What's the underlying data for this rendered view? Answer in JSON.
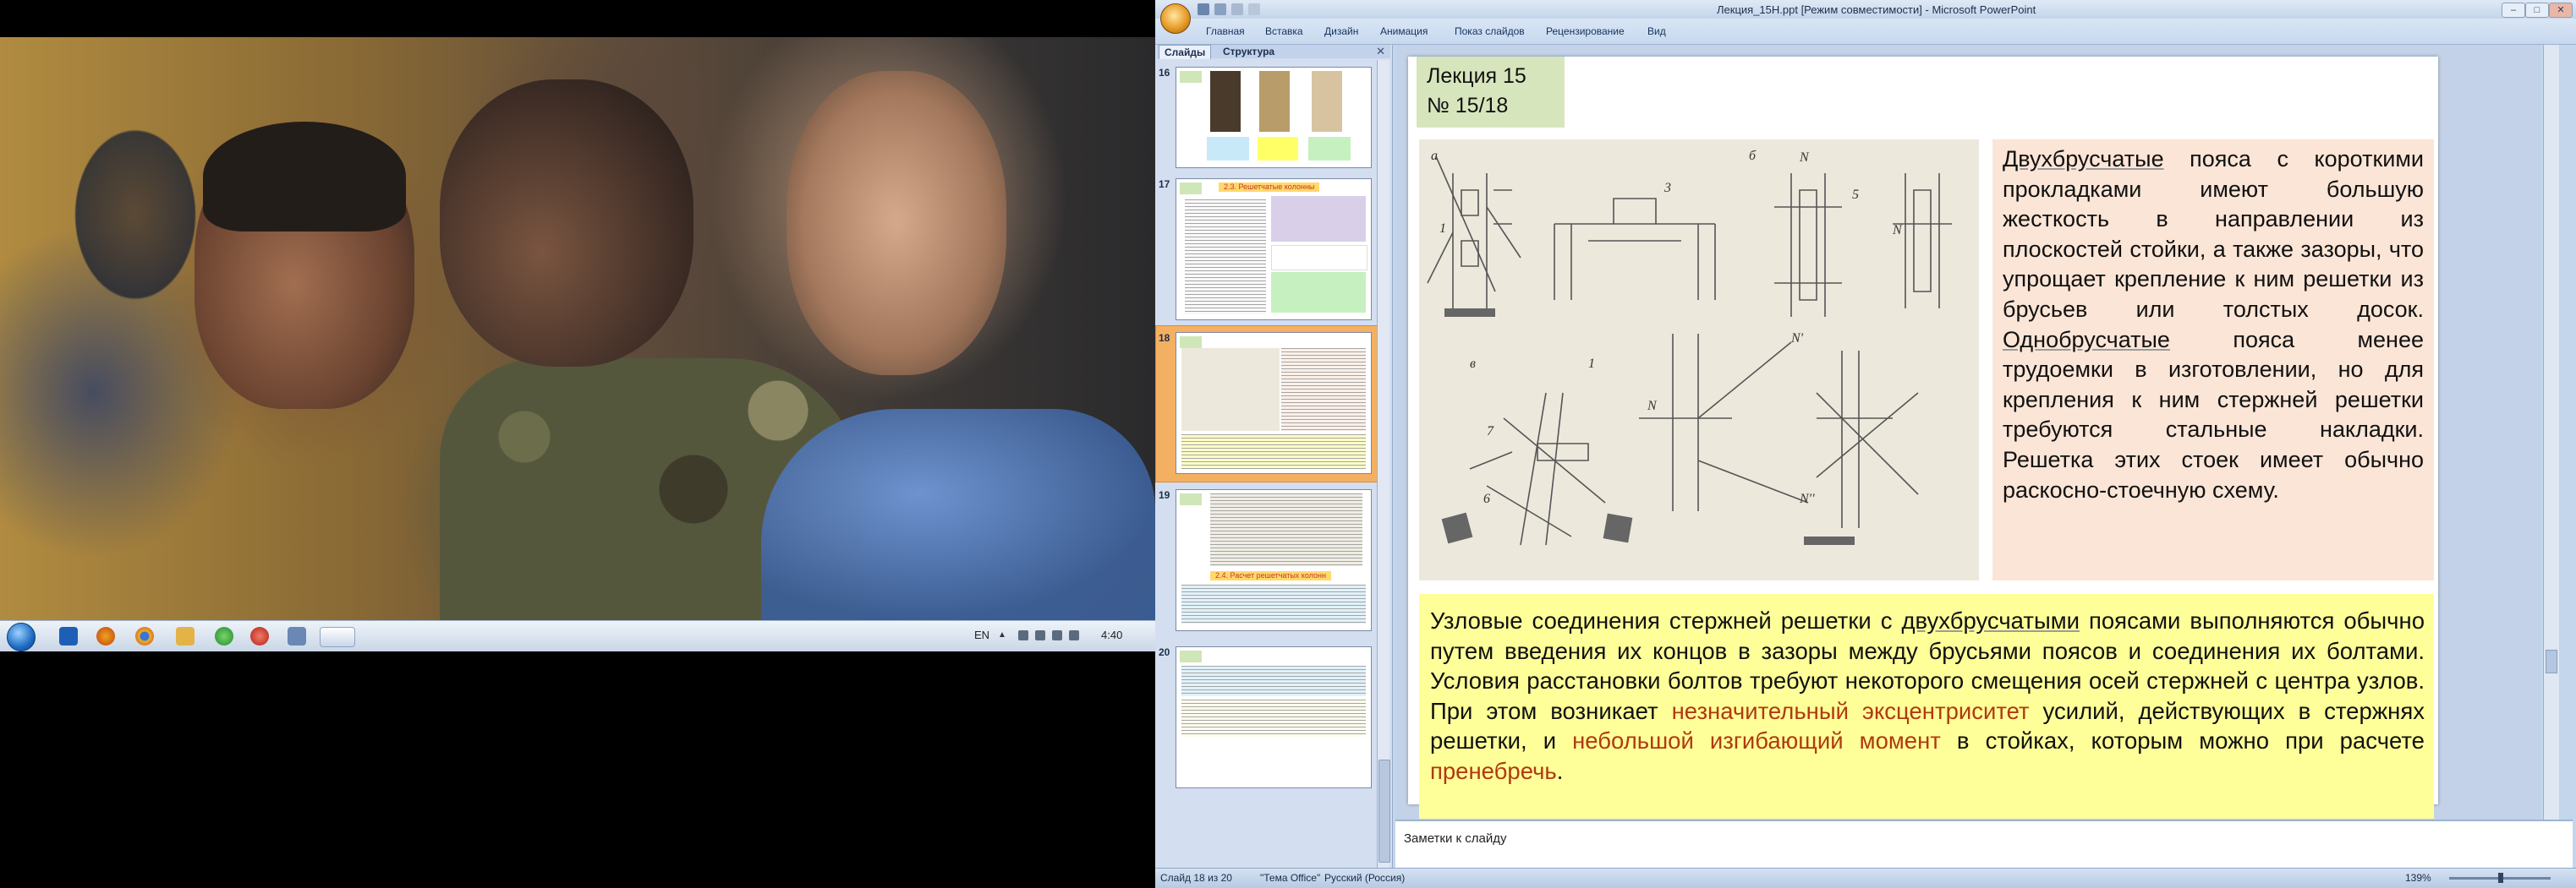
{
  "taskbar": {
    "lang": "EN",
    "clock": "4:40",
    "icons": [
      "start",
      "media-player",
      "firefox",
      "chrome",
      "file-explorer",
      "green-app",
      "red-app",
      "window-app",
      "active-app"
    ]
  },
  "ppt": {
    "window_title": "Лекция_15Н.ppt [Режим совместимости] - Microsoft PowerPoint",
    "ribbon_tabs": [
      "Главная",
      "Вставка",
      "Дизайн",
      "Анимация",
      "Показ слайдов",
      "Рецензирование",
      "Вид"
    ],
    "panel_tabs": {
      "slides": "Слайды",
      "outline": "Структура"
    },
    "thumbnails": [
      {
        "num": "16"
      },
      {
        "num": "17",
        "heading": "2.3. Решетчатые колонны"
      },
      {
        "num": "18",
        "selected": true
      },
      {
        "num": "19",
        "heading": "2.4. Расчет решетчатых колонн"
      },
      {
        "num": "20"
      }
    ],
    "slide": {
      "lecture": "Лекция 15",
      "number": "№ 15/18",
      "right_text": {
        "w1": "Двухбрусчатые",
        "t1": " пояса с короткими прокладками имеют большую жесткость в направлении из плоскостей стойки, а также зазоры, что упрощает крепление к ним решетки из брусьев или толстых досок. ",
        "w2": "Однобрусчатые",
        "t2": " пояса менее трудоемки в изготовлении, но для крепления к ним стержней решетки требуются стальные накладки. Решетка этих стоек имеет обычно раскосно-стоечную схему."
      },
      "bottom_text": {
        "t1": "Узловые соединения стержней решетки с ",
        "w1": "двухбрусчатыми",
        "t2": " поясами выполняются обычно путем введения их концов в зазоры между брусьями поясов и соединения их болтами. Условия расстановки болтов требуют некоторого смещения осей стержней с центра узлов. При этом возникает ",
        "h1": "незначительный эксцентриситет",
        "t3": " усилий, действующих в стержнях решетки, и ",
        "h2": "небольшой изгибающий момент",
        "t4": " в стойках, которым можно при расчете ",
        "h3": "пренебречь",
        "t5": "."
      },
      "drawing_labels": [
        "a",
        "б",
        "в",
        "1",
        "3",
        "N",
        "N",
        "5",
        "1",
        "7",
        "N'",
        "N''",
        "N",
        "6"
      ]
    },
    "notes_placeholder": "Заметки к слайду",
    "status": {
      "slide_info": "Слайд 18 из 20",
      "theme": "\"Тема Office\"",
      "language": "Русский (Россия)",
      "zoom": "139%"
    }
  }
}
